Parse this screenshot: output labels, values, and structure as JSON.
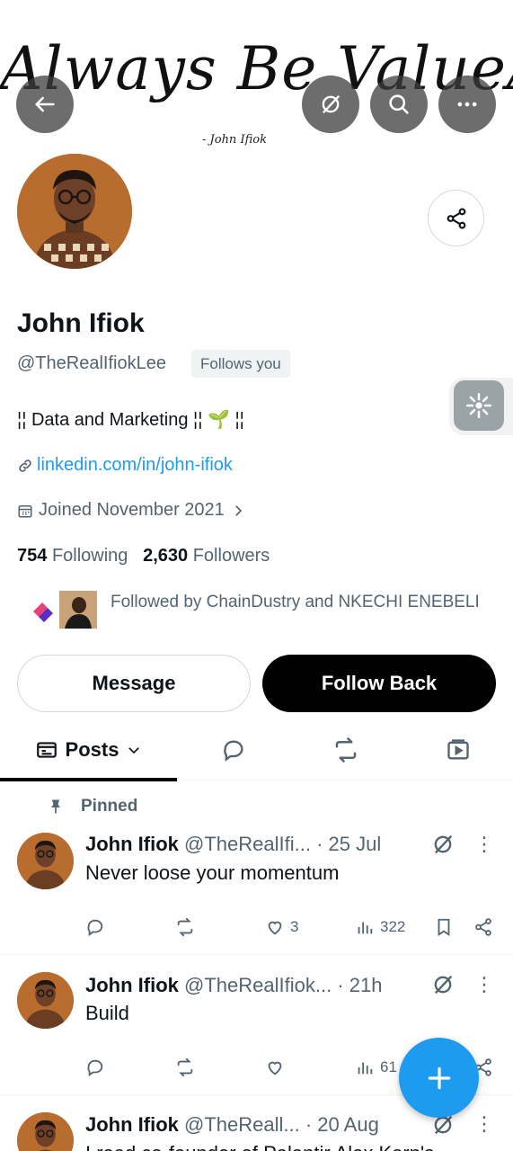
{
  "banner": {
    "headline": "Always Be ValueAble",
    "signature": "- John Ifiok"
  },
  "profile": {
    "name": "John Ifiok",
    "handle": "@TheRealIfiokLee",
    "follows_you": "Follows you",
    "bio": "¦¦ Data and Marketing ¦¦ 🌱 ¦¦",
    "link": "linkedin.com/in/john-ifiok",
    "joined": "Joined November 2021",
    "following_count": "754",
    "following_label": "Following",
    "followers_count": "2,630",
    "followers_label": "Followers",
    "followed_by": "Followed by ChainDustry and NKECHI ENEBELI"
  },
  "buttons": {
    "message": "Message",
    "follow_back": "Follow Back"
  },
  "tabs": {
    "posts": "Posts"
  },
  "pinned_label": "Pinned",
  "posts": [
    {
      "name": "John Ifiok",
      "handle": "@TheRealIfi...",
      "time": "· 25 Jul",
      "text": "Never loose your momentum",
      "likes": "3",
      "views": "322"
    },
    {
      "name": "John Ifiok",
      "handle": "@TheRealIfiok...",
      "time": "· 21h",
      "text": "Build",
      "likes": "",
      "views": "61"
    },
    {
      "name": "John Ifiok",
      "handle": "@TheReall...",
      "time": "· 20 Aug",
      "text": "I read co-founder of Palantir Alex Karp's",
      "likes": "",
      "views": ""
    }
  ],
  "colors": {
    "accent": "#1d9bf0",
    "text": "#0f1419",
    "muted": "#536471"
  }
}
